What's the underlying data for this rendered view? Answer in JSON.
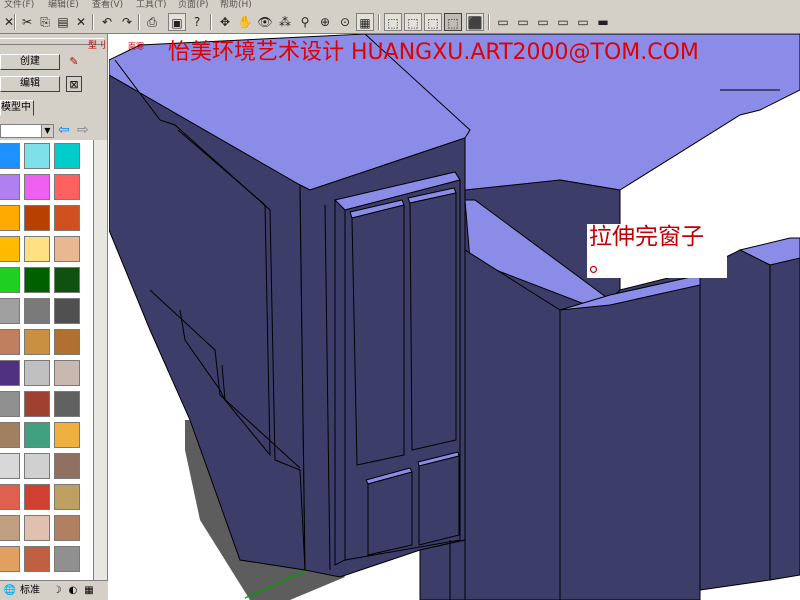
{
  "menu": [
    "文件(F)",
    "编辑(E)",
    "查看(V)",
    "工具(T)",
    "页面(P)",
    "帮助(H)"
  ],
  "panel": {
    "create_label": "创建",
    "edit_label": "编辑",
    "tab_model_label": "模型中",
    "scene_label": "型刂",
    "bottom_tab_label": "标准"
  },
  "watermark": "怡美环境艺术设计  HUANGXU.ART2000@TOM.COM",
  "scene_tag": "面寒",
  "caption": {
    "line1": "拉伸完窗子",
    "line2": "。"
  },
  "colors": {
    "building_face": "#3d3d6a",
    "building_top": "#8b8be8",
    "shadow": "#5d5d5d",
    "watermark": "#e00000"
  },
  "swatches": [
    [
      "#1e90ff",
      "#7ee0e8",
      "#00cccc"
    ],
    [
      "#b080f0",
      "#f060f0",
      "#ff6060"
    ],
    [
      "#ffaa00",
      "#b84000",
      "#d05020"
    ],
    [
      "#ffbb00",
      "#ffe080",
      "#e8b890"
    ],
    [
      "#20d020",
      "#006000",
      "#105010"
    ],
    [
      "#a0a0a0",
      "#7a7a7a",
      "#505050"
    ],
    [
      "#c08060",
      "#c89040",
      "#b07030"
    ],
    [
      "#503080",
      "#c0c0c0",
      "#c8b8b0"
    ],
    [
      "#909090",
      "#a04030",
      "#606060"
    ],
    [
      "#a08060",
      "#40a080",
      "#f0b040"
    ],
    [
      "#d8d8d8",
      "#d0d0d0",
      "#907060"
    ],
    [
      "#e06050",
      "#d04030",
      "#c0a060"
    ],
    [
      "#c0a080",
      "#e0c0b0",
      "#b08060"
    ],
    [
      "#e0a060",
      "#c06040",
      "#909090"
    ]
  ]
}
